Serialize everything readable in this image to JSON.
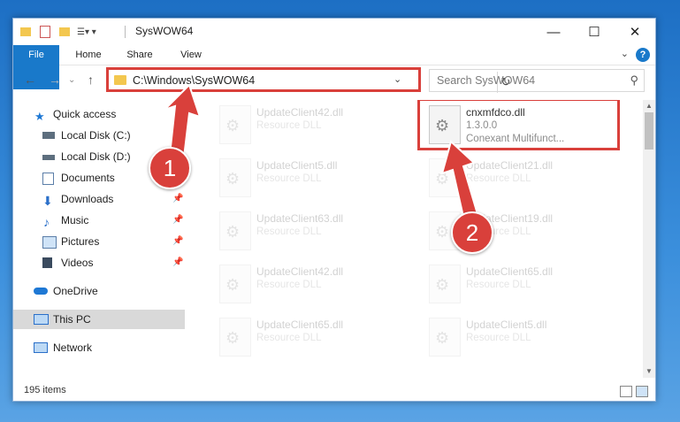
{
  "window": {
    "title": "SysWOW64",
    "controls": {
      "minimize": "—",
      "maximize": "☐",
      "close": "✕"
    }
  },
  "ribbon": {
    "tabs": [
      "File",
      "Home",
      "Share",
      "View"
    ],
    "help": "?"
  },
  "nav": {
    "address": "C:\\Windows\\SysWOW64",
    "search_placeholder": "Search SysWOW64"
  },
  "sidebar": {
    "items": [
      {
        "label": "Quick access",
        "icon": "star-icon",
        "color": "#1e78d4"
      },
      {
        "label": "Local Disk (C:)",
        "icon": "drive-icon",
        "color": "#5d6e7e"
      },
      {
        "label": "Local Disk (D:)",
        "icon": "drive-icon",
        "color": "#5d6e7e"
      },
      {
        "label": "Documents",
        "icon": "documents-icon",
        "color": "#5b7ea8"
      },
      {
        "label": "Downloads",
        "icon": "downloads-icon",
        "color": "#2a6fc9"
      },
      {
        "label": "Music",
        "icon": "music-icon",
        "color": "#2a6fc9"
      },
      {
        "label": "Pictures",
        "icon": "pictures-icon",
        "color": "#5b7ea8"
      },
      {
        "label": "Videos",
        "icon": "videos-icon",
        "color": "#5b7ea8"
      },
      {
        "label": "OneDrive",
        "icon": "cloud-icon",
        "color": "#1e78d4"
      },
      {
        "label": "This PC",
        "icon": "computer-icon",
        "color": "#2a6fc9"
      },
      {
        "label": "Network",
        "icon": "network-icon",
        "color": "#2a6fc9"
      }
    ]
  },
  "files": {
    "selected": {
      "name": "cnxmfdco.dll",
      "version": "1.3.0.0",
      "description": "Conexant Multifunct..."
    },
    "faded_left": [
      {
        "name": "UpdateClient42.dll",
        "type": "Resource DLL"
      },
      {
        "name": "UpdateClient5.dll",
        "type": "Resource DLL"
      },
      {
        "name": "UpdateClient63.dll",
        "type": "Resource DLL"
      },
      {
        "name": "UpdateClient42.dll",
        "type": "Resource DLL"
      },
      {
        "name": "UpdateClient65.dll",
        "type": "Resource DLL"
      }
    ],
    "faded_right": [
      {
        "name": "UpdateClient21.dll",
        "type": "Resource DLL"
      },
      {
        "name": "UpdateClient19.dll",
        "type": "Resource DLL"
      },
      {
        "name": "UpdateClient65.dll",
        "type": "Resource DLL"
      },
      {
        "name": "UpdateClient5.dll",
        "type": "Resource DLL"
      }
    ]
  },
  "status": {
    "item_count": "195 items"
  },
  "annotations": {
    "step1": "1",
    "step2": "2",
    "color": "#d9403b"
  }
}
